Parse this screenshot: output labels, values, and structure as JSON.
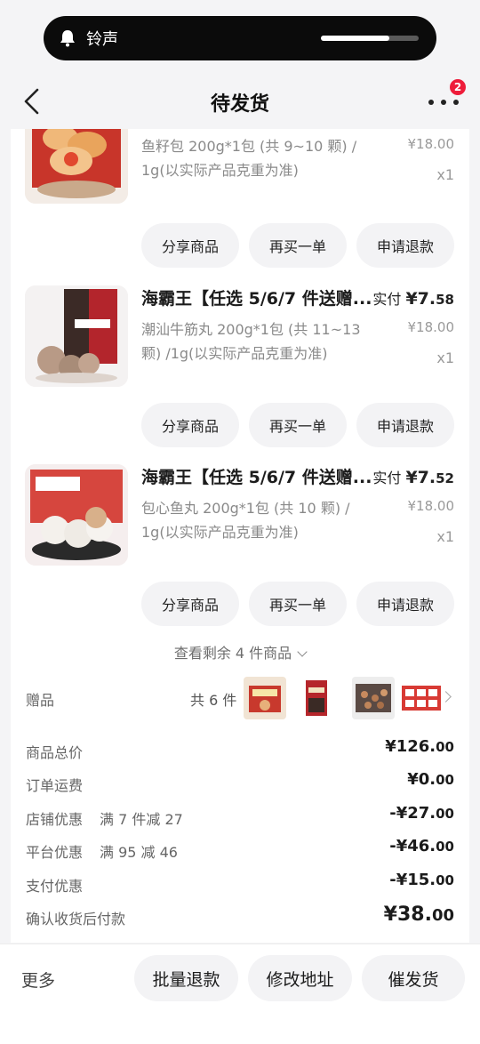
{
  "status_pill": {
    "label": "铃声",
    "volume_fraction": 0.7
  },
  "header": {
    "title": "待发货",
    "notification_count": "2"
  },
  "items": [
    {
      "name": "",
      "paid_label": "",
      "paid_int": "",
      "paid_dec": "",
      "spec": "鱼籽包 200g*1包 (共 9~10 颗) / 1g(以实际产品克重为准)",
      "orig_price": "¥18.00",
      "qty": "x1"
    },
    {
      "name": "海霸王【任选 5/6/7 件送赠...",
      "paid_label": "实付",
      "paid_int": "¥7.",
      "paid_dec": "58",
      "spec": "潮汕牛筋丸 200g*1包 (共 11~13 颗) /1g(以实际产品克重为准)",
      "orig_price": "¥18.00",
      "qty": "x1"
    },
    {
      "name": "海霸王【任选 5/6/7 件送赠...",
      "paid_label": "实付",
      "paid_int": "¥7.",
      "paid_dec": "52",
      "spec": "包心鱼丸 200g*1包 (共 10 颗) / 1g(以实际产品克重为准)",
      "orig_price": "¥18.00",
      "qty": "x1"
    }
  ],
  "item_actions": {
    "share": "分享商品",
    "rebuy": "再买一单",
    "refund": "申请退款"
  },
  "view_more": "查看剩余 4 件商品",
  "gifts": {
    "label": "赠品",
    "count": "共 6 件"
  },
  "summary": {
    "goods_total": {
      "label": "商品总价",
      "int": "¥126.",
      "dec": "00"
    },
    "shipping": {
      "label": "订单运费",
      "int": "¥0.",
      "dec": "00"
    },
    "shop_discount": {
      "label": "店铺优惠",
      "note": "满 7 件减 27",
      "int": "-¥27.",
      "dec": "00"
    },
    "platform_discount": {
      "label": "平台优惠",
      "note": "满 95 减 46",
      "int": "-¥46.",
      "dec": "00"
    },
    "payment_discount": {
      "label": "支付优惠",
      "int": "-¥15.",
      "dec": "00"
    },
    "pay_on_receipt": {
      "label": "确认收货后付款",
      "int": "¥38.",
      "dec": "00"
    }
  },
  "footer": {
    "more": "更多",
    "batch_refund": "批量退款",
    "change_address": "修改地址",
    "urge_ship": "催发货"
  },
  "colors": {
    "accent_red": "#ee1c3a",
    "button_bg": "#f3f3f5"
  }
}
